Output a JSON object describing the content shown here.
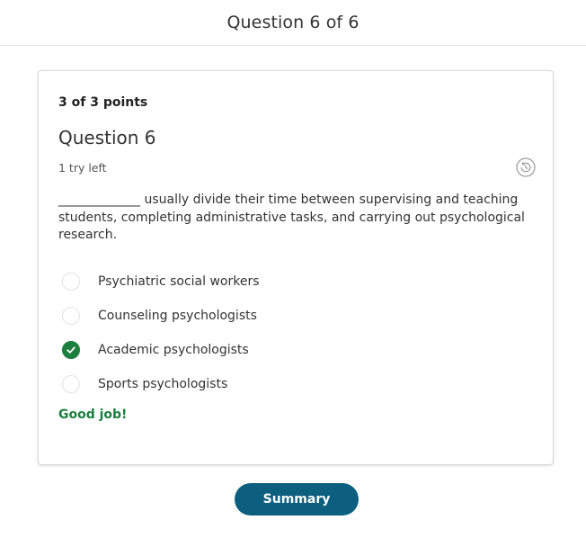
{
  "header": {
    "title": "Question 6 of 6"
  },
  "question": {
    "points": "3 of 3 points",
    "title": "Question 6",
    "tries": "1 try left",
    "prompt": "_____________ usually divide their time between supervising and teaching students, completing administrative tasks, and carrying out psychological research.",
    "options": [
      {
        "label": "Psychiatric social workers",
        "selected": false
      },
      {
        "label": "Counseling psychologists",
        "selected": false
      },
      {
        "label": "Academic psychologists",
        "selected": true
      },
      {
        "label": "Sports psychologists",
        "selected": false
      }
    ],
    "feedback": "Good job!",
    "history_icon": "history-icon"
  },
  "footer": {
    "summary_label": "Summary"
  },
  "colors": {
    "correct_green": "#1a7f3c",
    "button_blue": "#0c5f7e"
  }
}
